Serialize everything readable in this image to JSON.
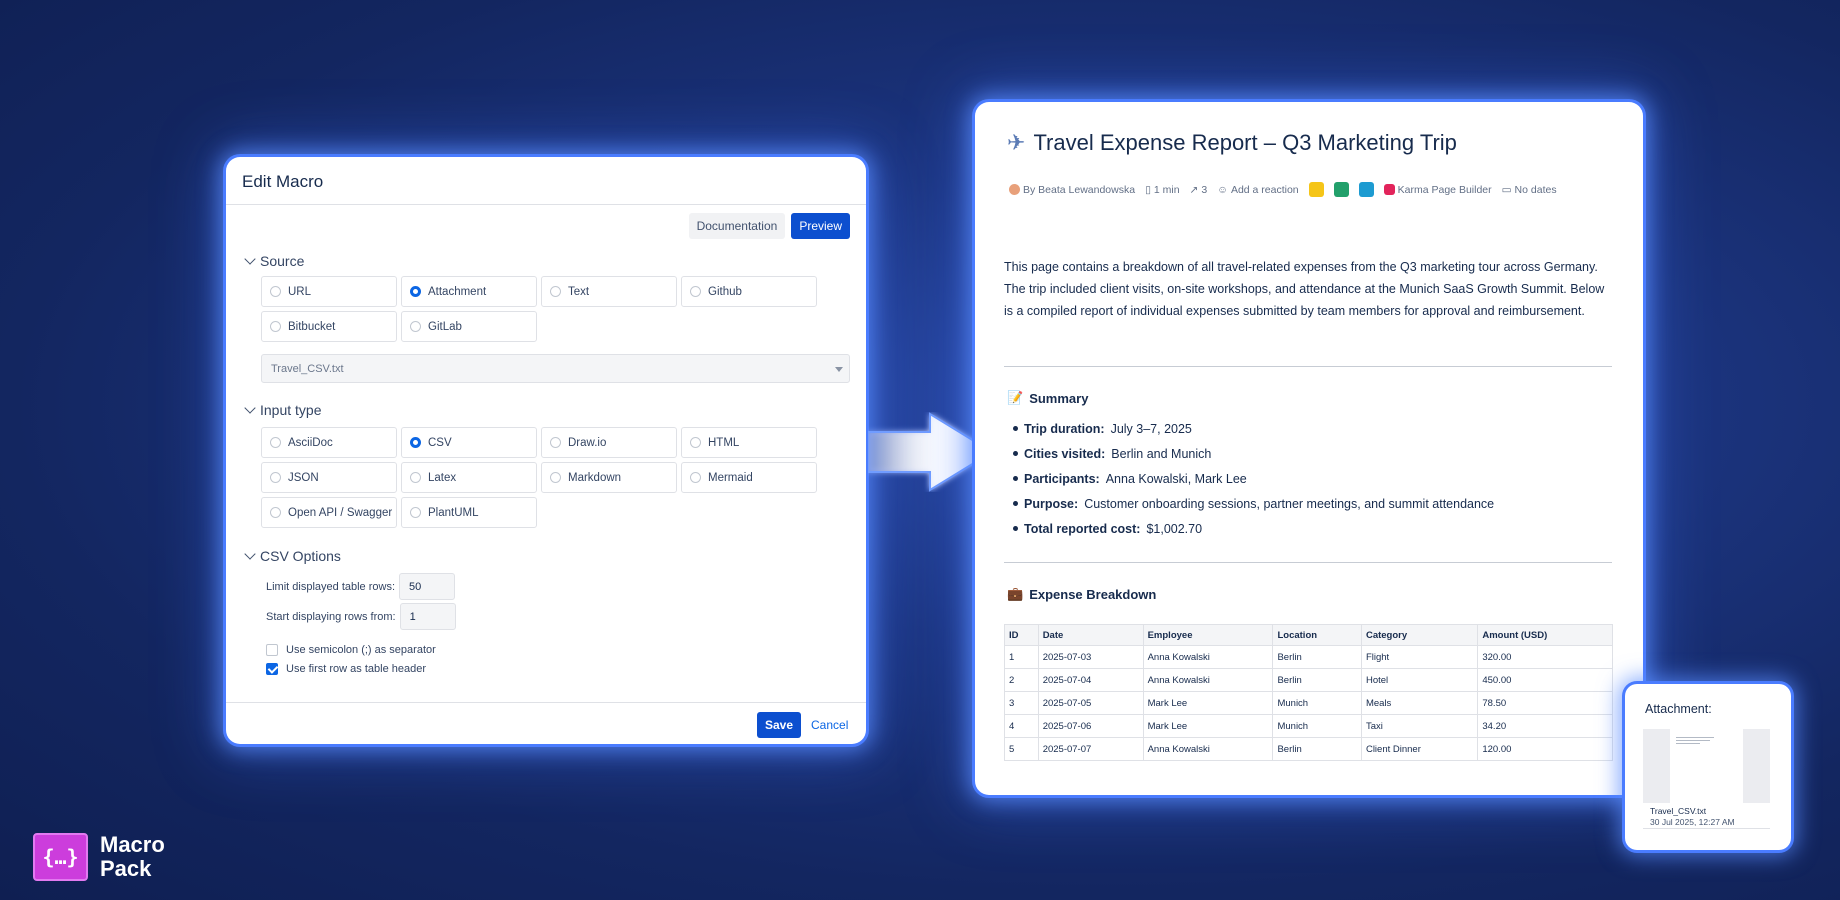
{
  "dialog": {
    "title": "Edit Macro",
    "documentation_label": "Documentation",
    "preview_label": "Preview",
    "source_heading": "Source",
    "source_options": [
      "URL",
      "Attachment",
      "Text",
      "Github",
      "Bitbucket",
      "GitLab"
    ],
    "source_selected": "Attachment",
    "attachment_value": "Travel_CSV.txt",
    "input_type_heading": "Input type",
    "input_options": [
      "AsciiDoc",
      "CSV",
      "Draw.io",
      "HTML",
      "JSON",
      "Latex",
      "Markdown",
      "Mermaid",
      "Open API / Swagger",
      "PlantUML"
    ],
    "input_selected": "CSV",
    "csv_heading": "CSV Options",
    "limit_label": "Limit displayed table rows:",
    "limit_value": "50",
    "start_label": "Start displaying rows from:",
    "start_value": "1",
    "semicolon_label": "Use semicolon (;) as separator",
    "semicolon_checked": false,
    "header_label": "Use first row as table header",
    "header_checked": true,
    "save_label": "Save",
    "cancel_label": "Cancel"
  },
  "page": {
    "icon": "airplane-icon",
    "title": "Travel Expense Report – Q3 Marketing Trip",
    "meta": {
      "author": "By Beata Lewandowska",
      "read_time": "1 min",
      "views": "3",
      "reaction": "Add a reaction",
      "builder": "Karma Page Builder",
      "dates": "No dates"
    },
    "intro": "This page contains a breakdown of all travel-related expenses from the Q3 marketing tour across Germany. The trip included client visits, on-site workshops, and attendance at the Munich SaaS Growth Summit. Below is a compiled report of individual expenses submitted by team members for approval and reimbursement.",
    "summary_heading": "Summary",
    "summary": [
      {
        "label": "Trip duration:",
        "value": "July 3–7, 2025"
      },
      {
        "label": "Cities visited:",
        "value": "Berlin and Munich"
      },
      {
        "label": "Participants:",
        "value": "Anna Kowalski, Mark Lee"
      },
      {
        "label": "Purpose:",
        "value": "Customer onboarding sessions, partner meetings, and summit attendance"
      },
      {
        "label": "Total reported cost:",
        "value": "$1,002.70"
      }
    ],
    "breakdown_heading": "Expense Breakdown",
    "table_headers": [
      "ID",
      "Date",
      "Employee",
      "Location",
      "Category",
      "Amount (USD)"
    ],
    "table_rows": [
      [
        "1",
        "2025-07-03",
        "Anna Kowalski",
        "Berlin",
        "Flight",
        "320.00"
      ],
      [
        "2",
        "2025-07-04",
        "Anna Kowalski",
        "Berlin",
        "Hotel",
        "450.00"
      ],
      [
        "3",
        "2025-07-05",
        "Mark Lee",
        "Munich",
        "Meals",
        "78.50"
      ],
      [
        "4",
        "2025-07-06",
        "Mark Lee",
        "Munich",
        "Taxi",
        "34.20"
      ],
      [
        "5",
        "2025-07-07",
        "Anna Kowalski",
        "Berlin",
        "Client Dinner",
        "120.00"
      ]
    ]
  },
  "attachment": {
    "label": "Attachment:",
    "file_name": "Travel_CSV.txt",
    "file_date": "30 Jul 2025, 12:27 AM"
  },
  "brand": {
    "logo_glyph": "{…}",
    "name_line1": "Macro",
    "name_line2": "Pack",
    "logo_color": "#cc3ddc"
  },
  "colors": {
    "primary_button": "#0c4fcf",
    "background": "#132660",
    "glow": "#4a7cff"
  }
}
